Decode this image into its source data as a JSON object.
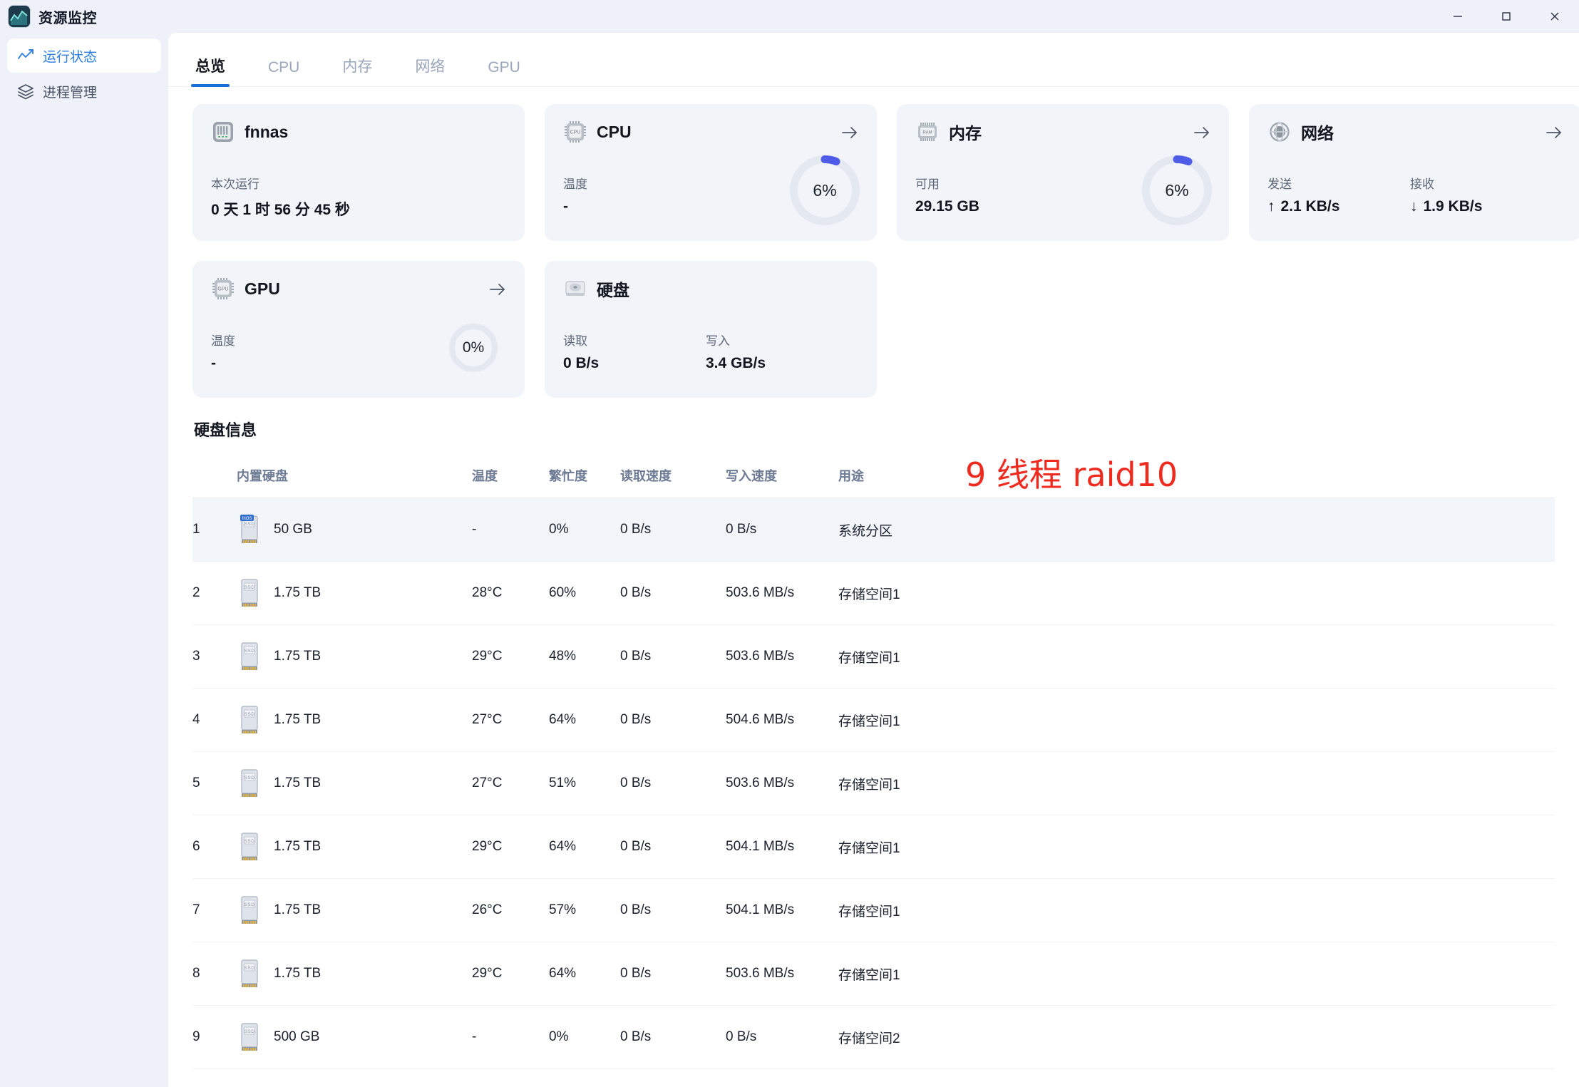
{
  "window": {
    "title": "资源监控",
    "logo_icon": "chart-logo-icon",
    "controls": {
      "minimize": "–",
      "maximize": "□",
      "close": "✕"
    }
  },
  "sidebar": {
    "items": [
      {
        "label": "运行状态",
        "icon": "activity-icon",
        "active": true
      },
      {
        "label": "进程管理",
        "icon": "layers-icon",
        "active": false
      }
    ]
  },
  "tabs": [
    {
      "label": "总览",
      "active": true
    },
    {
      "label": "CPU",
      "active": false
    },
    {
      "label": "内存",
      "active": false
    },
    {
      "label": "网络",
      "active": false
    },
    {
      "label": "GPU",
      "active": false
    }
  ],
  "cards": {
    "host": {
      "title": "fnnas",
      "icon": "nas-server-icon",
      "metric_label": "本次运行",
      "metric_value": "0 天 1 时 56 分 45 秒"
    },
    "cpu": {
      "title": "CPU",
      "icon": "cpu-chip-icon",
      "metric_label": "温度",
      "metric_value": "-",
      "gauge_percent": "6%",
      "gauge_value": 6,
      "arrow": "→"
    },
    "memory": {
      "title": "内存",
      "icon": "ram-chip-icon",
      "metric_label": "可用",
      "metric_value": "29.15 GB",
      "gauge_percent": "6%",
      "gauge_value": 6,
      "arrow": "→"
    },
    "network": {
      "title": "网络",
      "icon": "globe-network-icon",
      "send_label": "发送",
      "send_value": "2.1 KB/s",
      "send_arrow": "↑",
      "recv_label": "接收",
      "recv_value": "1.9 KB/s",
      "recv_arrow": "↓",
      "arrow": "→"
    },
    "gpu": {
      "title": "GPU",
      "icon": "gpu-chip-icon",
      "metric_label": "温度",
      "metric_value": "-",
      "gauge_percent": "0%",
      "gauge_value": 0,
      "arrow": "→"
    },
    "disk": {
      "title": "硬盘",
      "icon": "hard-disk-icon",
      "read_label": "读取",
      "read_value": "0 B/s",
      "write_label": "写入",
      "write_value": "3.4 GB/s"
    }
  },
  "annotation": {
    "text": "9 线程 raid10",
    "color": "#ef2a1f"
  },
  "disk_section": {
    "title": "硬盘信息",
    "columns": [
      "",
      "内置硬盘",
      "温度",
      "繁忙度",
      "读取速度",
      "写入速度",
      "用途"
    ],
    "rows": [
      {
        "idx": "1",
        "name": "50 GB",
        "badge": "fnOS",
        "temp": "-",
        "busy": "0%",
        "read": "0 B/s",
        "write": "0 B/s",
        "use": "系统分区",
        "highlight": true
      },
      {
        "idx": "2",
        "name": "1.75 TB",
        "badge": "",
        "temp": "28°C",
        "busy": "60%",
        "read": "0 B/s",
        "write": "503.6 MB/s",
        "use": "存储空间1",
        "highlight": false
      },
      {
        "idx": "3",
        "name": "1.75 TB",
        "badge": "",
        "temp": "29°C",
        "busy": "48%",
        "read": "0 B/s",
        "write": "503.6 MB/s",
        "use": "存储空间1",
        "highlight": false
      },
      {
        "idx": "4",
        "name": "1.75 TB",
        "badge": "",
        "temp": "27°C",
        "busy": "64%",
        "read": "0 B/s",
        "write": "504.6 MB/s",
        "use": "存储空间1",
        "highlight": false
      },
      {
        "idx": "5",
        "name": "1.75 TB",
        "badge": "",
        "temp": "27°C",
        "busy": "51%",
        "read": "0 B/s",
        "write": "503.6 MB/s",
        "use": "存储空间1",
        "highlight": false
      },
      {
        "idx": "6",
        "name": "1.75 TB",
        "badge": "",
        "temp": "29°C",
        "busy": "64%",
        "read": "0 B/s",
        "write": "504.1 MB/s",
        "use": "存储空间1",
        "highlight": false
      },
      {
        "idx": "7",
        "name": "1.75 TB",
        "badge": "",
        "temp": "26°C",
        "busy": "57%",
        "read": "0 B/s",
        "write": "504.1 MB/s",
        "use": "存储空间1",
        "highlight": false
      },
      {
        "idx": "8",
        "name": "1.75 TB",
        "badge": "",
        "temp": "29°C",
        "busy": "64%",
        "read": "0 B/s",
        "write": "503.6 MB/s",
        "use": "存储空间1",
        "highlight": false
      },
      {
        "idx": "9",
        "name": "500 GB",
        "badge": "",
        "temp": "-",
        "busy": "0%",
        "read": "0 B/s",
        "write": "0 B/s",
        "use": "存储空间2",
        "highlight": false
      }
    ]
  },
  "colors": {
    "accent_blue": "#1a6fd4",
    "gauge_blue": "#4f5ce8",
    "sidebar_bg": "#eef1f7",
    "card_bg": "#f1f4f9",
    "annotation_red": "#ef2a1f"
  }
}
